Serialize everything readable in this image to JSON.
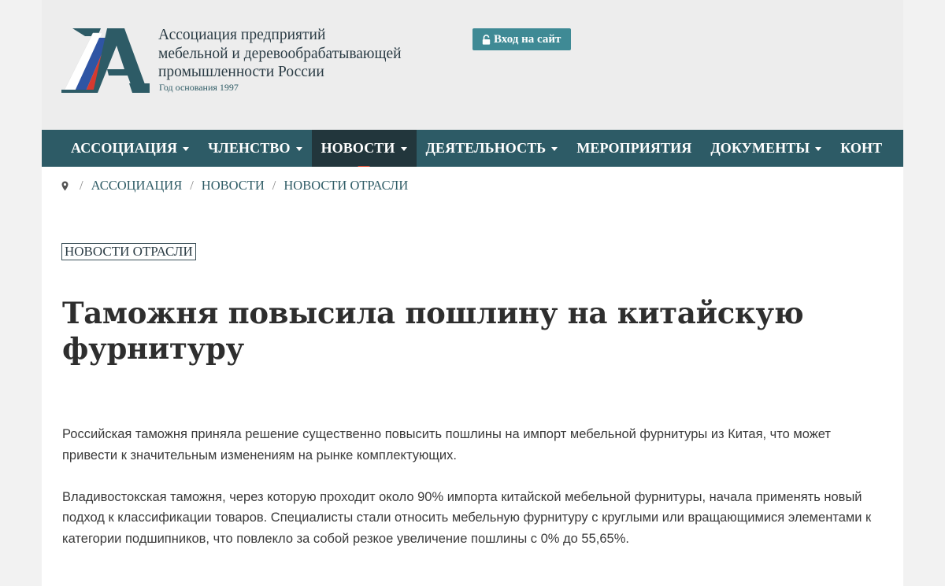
{
  "header": {
    "org_name_line1": "Ассоциация предприятий",
    "org_name_line2": "мебельной и деревообрабатывающей",
    "org_name_line3": "промышленности России",
    "founded": "Год основания 1997",
    "login_label": "Вход на сайт",
    "logo_icon": "association-logo",
    "colors": {
      "brand": "#2d5b66",
      "accent_red": "#d9452a",
      "button": "#3f8a95"
    }
  },
  "nav": {
    "items": [
      {
        "label": "АССОЦИАЦИЯ",
        "dropdown": true
      },
      {
        "label": "ЧЛЕНСТВО",
        "dropdown": true
      },
      {
        "label": "НОВОСТИ",
        "dropdown": true,
        "active": true
      },
      {
        "label": "ДЕЯТЕЛЬНОСТЬ",
        "dropdown": true
      },
      {
        "label": "МЕРОПРИЯТИЯ",
        "dropdown": false
      },
      {
        "label": "ДОКУМЕНТЫ",
        "dropdown": true
      },
      {
        "label": "КОНТ",
        "dropdown": false
      }
    ]
  },
  "breadcrumb": {
    "home_icon": "map-marker-icon",
    "items": [
      "АССОЦИАЦИЯ",
      "НОВОСТИ",
      "НОВОСТИ ОТРАСЛИ"
    ]
  },
  "article": {
    "category": "НОВОСТИ ОТРАСЛИ",
    "title": "Таможня повысила пошлину на китайскую фурнитуру",
    "paragraphs": [
      "Российская таможня приняла решение существенно повысить пошлины на импорт мебельной фурнитуры из Китая, что может привести к значительным изменениям на рынке комплектующих.",
      "Владивостокская таможня, через которую проходит около 90% импорта китайской мебельной фурнитуры, начала применять новый подход к классификации товаров. Специалисты стали относить мебельную фурнитуру с круглыми или вращающимися элементами к категории подшипников, что повлекло за собой резкое увеличение пошлины с 0% до 55,65%."
    ]
  }
}
